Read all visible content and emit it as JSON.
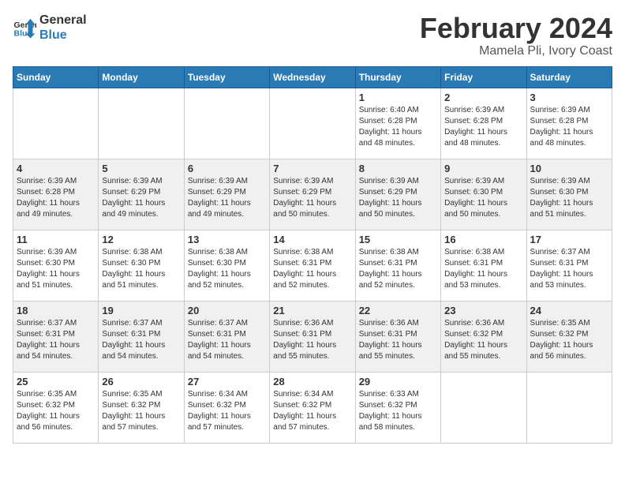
{
  "header": {
    "logo_line1": "General",
    "logo_line2": "Blue",
    "title": "February 2024",
    "subtitle": "Mamela Pli, Ivory Coast"
  },
  "calendar": {
    "days_of_week": [
      "Sunday",
      "Monday",
      "Tuesday",
      "Wednesday",
      "Thursday",
      "Friday",
      "Saturday"
    ],
    "weeks": [
      [
        {
          "day": "",
          "info": ""
        },
        {
          "day": "",
          "info": ""
        },
        {
          "day": "",
          "info": ""
        },
        {
          "day": "",
          "info": ""
        },
        {
          "day": "1",
          "info": "Sunrise: 6:40 AM\nSunset: 6:28 PM\nDaylight: 11 hours\nand 48 minutes."
        },
        {
          "day": "2",
          "info": "Sunrise: 6:39 AM\nSunset: 6:28 PM\nDaylight: 11 hours\nand 48 minutes."
        },
        {
          "day": "3",
          "info": "Sunrise: 6:39 AM\nSunset: 6:28 PM\nDaylight: 11 hours\nand 48 minutes."
        }
      ],
      [
        {
          "day": "4",
          "info": "Sunrise: 6:39 AM\nSunset: 6:28 PM\nDaylight: 11 hours\nand 49 minutes."
        },
        {
          "day": "5",
          "info": "Sunrise: 6:39 AM\nSunset: 6:29 PM\nDaylight: 11 hours\nand 49 minutes."
        },
        {
          "day": "6",
          "info": "Sunrise: 6:39 AM\nSunset: 6:29 PM\nDaylight: 11 hours\nand 49 minutes."
        },
        {
          "day": "7",
          "info": "Sunrise: 6:39 AM\nSunset: 6:29 PM\nDaylight: 11 hours\nand 50 minutes."
        },
        {
          "day": "8",
          "info": "Sunrise: 6:39 AM\nSunset: 6:29 PM\nDaylight: 11 hours\nand 50 minutes."
        },
        {
          "day": "9",
          "info": "Sunrise: 6:39 AM\nSunset: 6:30 PM\nDaylight: 11 hours\nand 50 minutes."
        },
        {
          "day": "10",
          "info": "Sunrise: 6:39 AM\nSunset: 6:30 PM\nDaylight: 11 hours\nand 51 minutes."
        }
      ],
      [
        {
          "day": "11",
          "info": "Sunrise: 6:39 AM\nSunset: 6:30 PM\nDaylight: 11 hours\nand 51 minutes."
        },
        {
          "day": "12",
          "info": "Sunrise: 6:38 AM\nSunset: 6:30 PM\nDaylight: 11 hours\nand 51 minutes."
        },
        {
          "day": "13",
          "info": "Sunrise: 6:38 AM\nSunset: 6:30 PM\nDaylight: 11 hours\nand 52 minutes."
        },
        {
          "day": "14",
          "info": "Sunrise: 6:38 AM\nSunset: 6:31 PM\nDaylight: 11 hours\nand 52 minutes."
        },
        {
          "day": "15",
          "info": "Sunrise: 6:38 AM\nSunset: 6:31 PM\nDaylight: 11 hours\nand 52 minutes."
        },
        {
          "day": "16",
          "info": "Sunrise: 6:38 AM\nSunset: 6:31 PM\nDaylight: 11 hours\nand 53 minutes."
        },
        {
          "day": "17",
          "info": "Sunrise: 6:37 AM\nSunset: 6:31 PM\nDaylight: 11 hours\nand 53 minutes."
        }
      ],
      [
        {
          "day": "18",
          "info": "Sunrise: 6:37 AM\nSunset: 6:31 PM\nDaylight: 11 hours\nand 54 minutes."
        },
        {
          "day": "19",
          "info": "Sunrise: 6:37 AM\nSunset: 6:31 PM\nDaylight: 11 hours\nand 54 minutes."
        },
        {
          "day": "20",
          "info": "Sunrise: 6:37 AM\nSunset: 6:31 PM\nDaylight: 11 hours\nand 54 minutes."
        },
        {
          "day": "21",
          "info": "Sunrise: 6:36 AM\nSunset: 6:31 PM\nDaylight: 11 hours\nand 55 minutes."
        },
        {
          "day": "22",
          "info": "Sunrise: 6:36 AM\nSunset: 6:31 PM\nDaylight: 11 hours\nand 55 minutes."
        },
        {
          "day": "23",
          "info": "Sunrise: 6:36 AM\nSunset: 6:32 PM\nDaylight: 11 hours\nand 55 minutes."
        },
        {
          "day": "24",
          "info": "Sunrise: 6:35 AM\nSunset: 6:32 PM\nDaylight: 11 hours\nand 56 minutes."
        }
      ],
      [
        {
          "day": "25",
          "info": "Sunrise: 6:35 AM\nSunset: 6:32 PM\nDaylight: 11 hours\nand 56 minutes."
        },
        {
          "day": "26",
          "info": "Sunrise: 6:35 AM\nSunset: 6:32 PM\nDaylight: 11 hours\nand 57 minutes."
        },
        {
          "day": "27",
          "info": "Sunrise: 6:34 AM\nSunset: 6:32 PM\nDaylight: 11 hours\nand 57 minutes."
        },
        {
          "day": "28",
          "info": "Sunrise: 6:34 AM\nSunset: 6:32 PM\nDaylight: 11 hours\nand 57 minutes."
        },
        {
          "day": "29",
          "info": "Sunrise: 6:33 AM\nSunset: 6:32 PM\nDaylight: 11 hours\nand 58 minutes."
        },
        {
          "day": "",
          "info": ""
        },
        {
          "day": "",
          "info": ""
        }
      ]
    ]
  }
}
